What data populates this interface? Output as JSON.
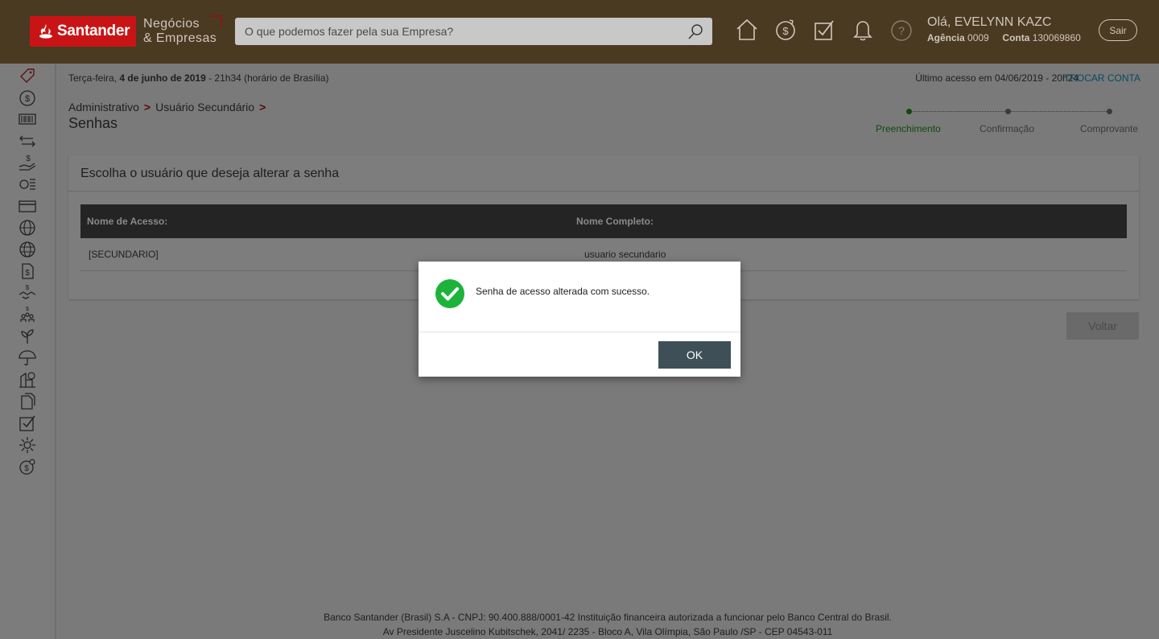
{
  "header": {
    "brand": "Santander",
    "subbrand_line1": "Negócios",
    "subbrand_line2": "& Empresas",
    "search_placeholder": "O que podemos fazer pela sua Empresa?",
    "greeting": "Olá, EVELYNN KAZC",
    "agencia_label": "Agência",
    "agencia_value": "0009",
    "conta_label": "Conta",
    "conta_value": "130069860",
    "logout_label": "Sair",
    "icons": [
      "home-icon",
      "dollar-circle-icon",
      "checkbox-icon",
      "bell-icon",
      "help-icon"
    ]
  },
  "sidebar": {
    "icons": [
      "tag-icon",
      "dollar-icon",
      "barcode-icon",
      "transfer-icon",
      "hand-money-icon",
      "bill-list-icon",
      "card-icon",
      "globe-icon",
      "globe-2-icon",
      "document-money-icon",
      "handshake-icon",
      "people-money-icon",
      "plant-icon",
      "umbrella-icon",
      "building-icon",
      "documents-icon",
      "checklist-icon",
      "gear-icon",
      "money-clock-icon"
    ]
  },
  "topbar": {
    "date_prefix": "Terça-feira,",
    "date_bold": "4 de junho de 2019",
    "date_suffix": "- 21h34 (horário de Brasília)",
    "last_access_label": "Último acesso em",
    "last_access_value": "04/06/2019 - 20h24",
    "change_account": "TROCAR CONTA"
  },
  "breadcrumb": {
    "items": [
      "Administrativo",
      "Usuário Secundário"
    ],
    "separator": ">",
    "title": "Senhas"
  },
  "steps": {
    "items": [
      "Preenchimento",
      "Confirmação",
      "Comprovante"
    ],
    "active": 0
  },
  "card": {
    "heading": "Escolha o usuário que deseja alterar a senha",
    "columns": [
      "Nome de Acesso:",
      "Nome Completo:"
    ],
    "rows": [
      [
        "[SECUNDARIO]",
        "usuario secundario"
      ]
    ]
  },
  "buttons": {
    "back": "Voltar"
  },
  "footer": {
    "line1": "Banco Santander (Brasil) S.A - CNPJ: 90.400.888/0001-42 Instituição financeira autorizada a funcionar pelo Banco Central do Brasil.",
    "line2": "Av Presidente Juscelino Kubitschek, 2041/ 2235 - Bloco A, Vila Olímpia, São Paulo /SP - CEP 04543-011"
  },
  "modal": {
    "message": "Senha de acesso alterada com sucesso.",
    "ok_label": "OK",
    "success_color": "#1db33b"
  }
}
